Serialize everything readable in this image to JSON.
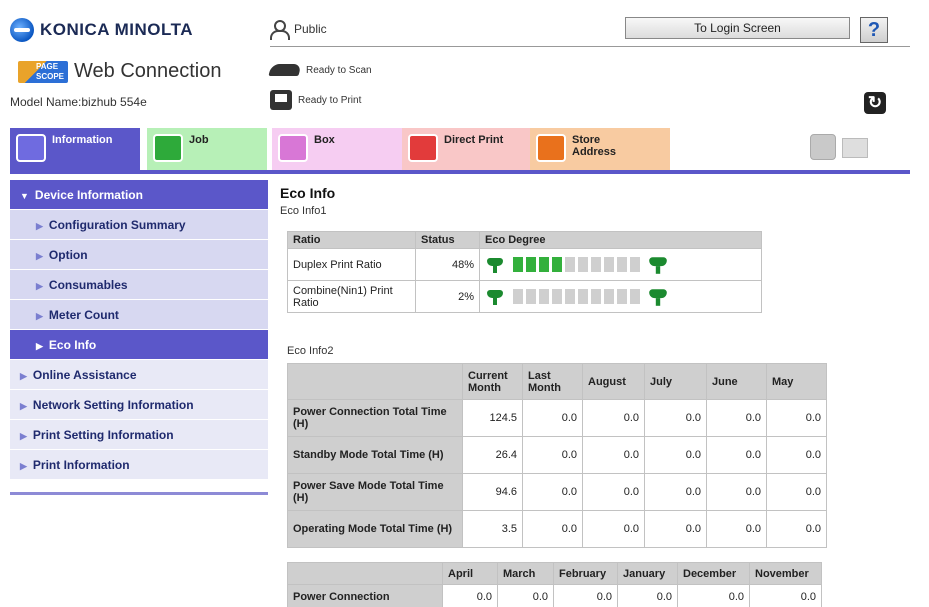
{
  "header": {
    "brand": "KONICA MINOLTA",
    "product_logo_text": "PAGE SCOPE",
    "product": "Web Connection",
    "model_name": "Model Name:bizhub 554e",
    "user": "Public",
    "login_button": "To Login Screen",
    "help_button": "?",
    "scan_status": "Ready to Scan",
    "print_status": "Ready to Print"
  },
  "tabs": [
    {
      "label": "Information"
    },
    {
      "label": "Job"
    },
    {
      "label": "Box"
    },
    {
      "label": "Direct Print"
    },
    {
      "label": "Store Address"
    }
  ],
  "sidebar": {
    "items": [
      {
        "label": "Device Information"
      },
      {
        "label": "Configuration Summary"
      },
      {
        "label": "Option"
      },
      {
        "label": "Consumables"
      },
      {
        "label": "Meter Count"
      },
      {
        "label": "Eco Info"
      },
      {
        "label": "Online Assistance"
      },
      {
        "label": "Network Setting Information"
      },
      {
        "label": "Print Setting Information"
      },
      {
        "label": "Print Information"
      }
    ]
  },
  "main": {
    "title": "Eco Info",
    "eco1": {
      "label": "Eco Info1",
      "headers": [
        "Ratio",
        "Status",
        "Eco Degree"
      ],
      "rows": [
        {
          "name": "Duplex Print Ratio",
          "status": "48%",
          "level": 4,
          "segments": 10
        },
        {
          "name": "Combine(Nin1) Print Ratio",
          "status": "2%",
          "level": 0,
          "segments": 10
        }
      ]
    },
    "eco2": {
      "label": "Eco Info2",
      "headers": [
        "",
        "Current Month",
        "Last Month",
        "August",
        "July",
        "June",
        "May"
      ],
      "rows": [
        {
          "name": "Power Connection Total Time (H)",
          "values": [
            "124.5",
            "0.0",
            "0.0",
            "0.0",
            "0.0",
            "0.0"
          ]
        },
        {
          "name": "Standby Mode Total Time (H)",
          "values": [
            "26.4",
            "0.0",
            "0.0",
            "0.0",
            "0.0",
            "0.0"
          ]
        },
        {
          "name": "Power Save Mode Total Time (H)",
          "values": [
            "94.6",
            "0.0",
            "0.0",
            "0.0",
            "0.0",
            "0.0"
          ]
        },
        {
          "name": "Operating Mode Total Time (H)",
          "values": [
            "3.5",
            "0.0",
            "0.0",
            "0.0",
            "0.0",
            "0.0"
          ]
        }
      ]
    },
    "eco3": {
      "headers": [
        "",
        "April",
        "March",
        "February",
        "January",
        "December",
        "November"
      ],
      "rows": [
        {
          "name": "Power Connection",
          "values": [
            "0.0",
            "0.0",
            "0.0",
            "0.0",
            "0.0",
            "0.0"
          ]
        }
      ]
    }
  }
}
